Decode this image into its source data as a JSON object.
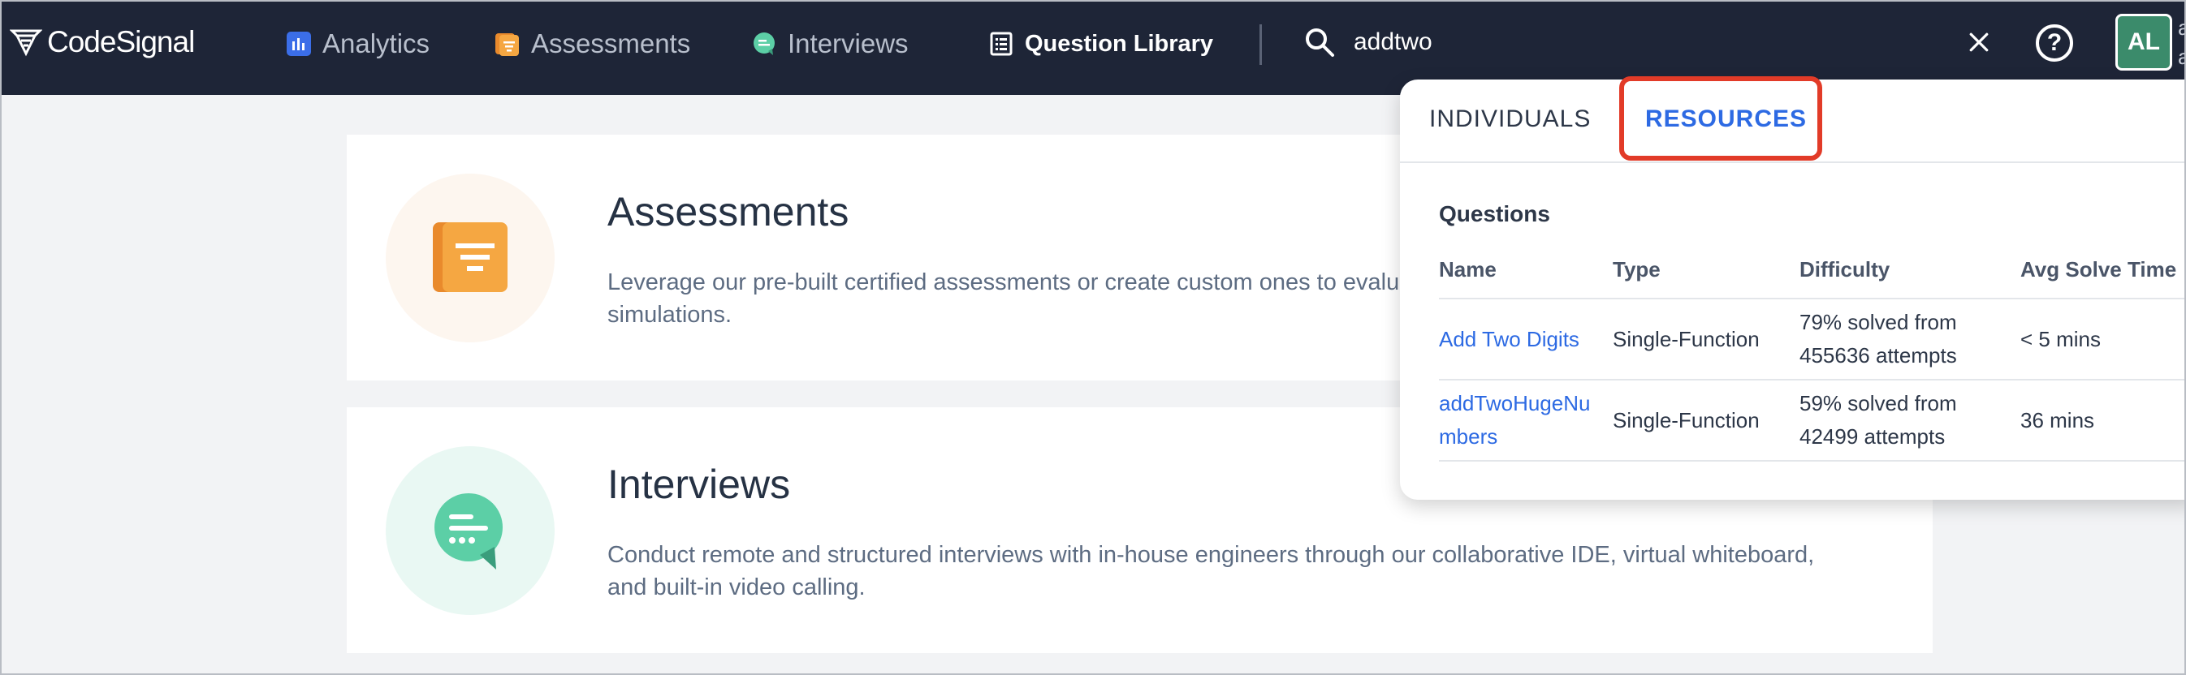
{
  "nav": {
    "logo_text": "CodeSignal",
    "items": [
      {
        "label": "Analytics",
        "icon": "analytics-icon",
        "color": "#3b6ee8"
      },
      {
        "label": "Assessments",
        "icon": "assessments-icon",
        "color": "#f0a33a"
      },
      {
        "label": "Interviews",
        "icon": "interviews-icon",
        "color": "#5ccfa6"
      },
      {
        "label": "Question Library",
        "icon": "question-library-icon",
        "color": "#ffffff"
      }
    ],
    "search_value": "addtwo",
    "help_label": "?",
    "avatar_initials": "AL",
    "avatar_side_text": "a a",
    "nav_bg": "#1e2537"
  },
  "cards": [
    {
      "title": "Assessments",
      "description": "Leverage our pre-built certified assessments or create custom ones to evaluate candidates using state-of-the-art job simulations.",
      "icon": "assessments-document-icon",
      "circle_color": "#fdf6ef"
    },
    {
      "title": "Interviews",
      "description": "Conduct remote and structured interviews with in-house engineers through our collaborative IDE, virtual whiteboard, and built-in video calling.",
      "icon": "interviews-chat-icon",
      "circle_color": "#e9f8f3"
    }
  ],
  "dropdown": {
    "tabs": [
      "INDIVIDUALS",
      "RESOURCES"
    ],
    "active_tab": "RESOURCES",
    "section_title": "Questions",
    "columns": [
      "Name",
      "Type",
      "Difficulty",
      "Avg Solve Time"
    ],
    "rows": [
      {
        "name": "Add Two Digits",
        "type": "Single-Function",
        "difficulty": "79% solved from 455636 attempts",
        "avg_solve_time": "< 5 mins"
      },
      {
        "name": "addTwoHugeNumbers",
        "type": "Single-Function",
        "difficulty": "59% solved from 42499 attempts",
        "avg_solve_time": "36 mins"
      }
    ]
  }
}
